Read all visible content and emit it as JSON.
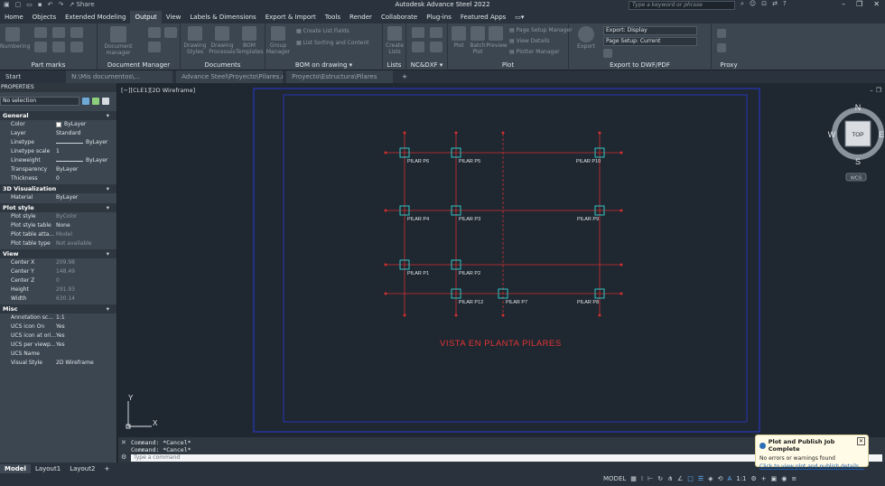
{
  "window": {
    "title": "Autodesk Advance Steel 2022",
    "share_label": "Share",
    "search_placeholder": "Type a keyword or phrase"
  },
  "ribbon_tabs": [
    "Home",
    "Objects",
    "Extended Modeling",
    "Output",
    "View",
    "Labels & Dimensions",
    "Export & Import",
    "Tools",
    "Render",
    "Collaborate",
    "Plug-ins",
    "Featured Apps"
  ],
  "ribbon_active_tab": "Output",
  "ribbon": {
    "groups": {
      "part_marks": "Part marks",
      "document_manager": "Document Manager",
      "documents": "Documents",
      "bom_on_drawing": "BOM on drawing",
      "lists": "Lists",
      "ncdxf": "NC&DXF",
      "plot": "Plot",
      "export_dwf": "Export to DWF/PDF",
      "proxy": "Proxy"
    },
    "buttons": {
      "numbering": "Numbering",
      "document_manager": "Document manager",
      "drawing_styles": "Drawing Styles",
      "drawing_processes": "Drawing Processes",
      "bom_templates": "BOM Templates",
      "group_manager": "Group Manager",
      "create_list_fields": "Create List Fields",
      "list_sorting": "List Sorting and Content",
      "create_lists": "Create Lists",
      "plot": "Plot",
      "batch_plot": "Batch Plot",
      "preview": "Preview",
      "page_setup_manager": "Page Setup Manager",
      "view_details": "View Details",
      "plotter_manager": "Plotter Manager",
      "export": "Export"
    },
    "export_select": "Export: Display",
    "page_setup_select": "Page Setup: Current"
  },
  "doc_tabs": {
    "start": "Start",
    "file1": "N:\\Mis documentos\\...",
    "file2": "Advance Steel\\Proyecto\\Pilares.dwg",
    "file3": "Proyecto\\Estructura\\Pilares"
  },
  "properties": {
    "header": "PROPERTIES",
    "selection": "No selection",
    "sections": {
      "general": {
        "title": "General",
        "rows": [
          {
            "k": "Color",
            "v": "ByLayer"
          },
          {
            "k": "Layer",
            "v": "Standard"
          },
          {
            "k": "Linetype",
            "v": "ByLayer"
          },
          {
            "k": "Linetype scale",
            "v": "1"
          },
          {
            "k": "Lineweight",
            "v": "ByLayer"
          },
          {
            "k": "Transparency",
            "v": "ByLayer"
          },
          {
            "k": "Thickness",
            "v": "0"
          }
        ]
      },
      "viz3d": {
        "title": "3D Visualization",
        "rows": [
          {
            "k": "Material",
            "v": "ByLayer"
          }
        ]
      },
      "plot_style": {
        "title": "Plot style",
        "rows": [
          {
            "k": "Plot style",
            "v": "ByColor"
          },
          {
            "k": "Plot style table",
            "v": "None"
          },
          {
            "k": "Plot table atta...",
            "v": "Model"
          },
          {
            "k": "Plot table type",
            "v": "Not available"
          }
        ]
      },
      "view": {
        "title": "View",
        "rows": [
          {
            "k": "Center X",
            "v": "209.98"
          },
          {
            "k": "Center Y",
            "v": "148.49"
          },
          {
            "k": "Center Z",
            "v": "0"
          },
          {
            "k": "Height",
            "v": "291.93"
          },
          {
            "k": "Width",
            "v": "630.14"
          }
        ]
      },
      "misc": {
        "title": "Misc",
        "rows": [
          {
            "k": "Annotation sc...",
            "v": "1:1"
          },
          {
            "k": "UCS icon On",
            "v": "Yes"
          },
          {
            "k": "UCS icon at ori...",
            "v": "Yes"
          },
          {
            "k": "UCS per viewp...",
            "v": "Yes"
          },
          {
            "k": "UCS Name",
            "v": ""
          },
          {
            "k": "Visual Style",
            "v": "2D Wireframe"
          }
        ]
      }
    }
  },
  "viewport": {
    "label": "[−][CLE1][2D Wireframe]",
    "viewcube": {
      "n": "N",
      "s": "S",
      "e": "E",
      "w": "W",
      "top": "TOP",
      "wcs": "WCS"
    }
  },
  "drawing": {
    "title": "VISTA EN PLANTA PILARES",
    "pillars": [
      {
        "label": "PILAR P6"
      },
      {
        "label": "PILAR P5"
      },
      {
        "label": "PILAR P10"
      },
      {
        "label": "PILAR P4"
      },
      {
        "label": "PILAR P3"
      },
      {
        "label": "PILAR P9"
      },
      {
        "label": "PILAR P1"
      },
      {
        "label": "PILAR P2"
      },
      {
        "label": "PILAR P12"
      },
      {
        "label": "PILAR P7"
      },
      {
        "label": "PILAR P8"
      }
    ],
    "ucs": {
      "y": "Y",
      "x": "X"
    }
  },
  "command": {
    "history": [
      "Command: *Cancel*",
      "Command: *Cancel*"
    ],
    "placeholder": "Type a command"
  },
  "layout_tabs": [
    "Model",
    "Layout1",
    "Layout2"
  ],
  "status": {
    "model": "MODEL",
    "scale": "1:1"
  },
  "notification": {
    "title": "Plot and Publish Job Complete",
    "message": "No errors or warnings found",
    "link": "Click to view plot and publish details..."
  }
}
